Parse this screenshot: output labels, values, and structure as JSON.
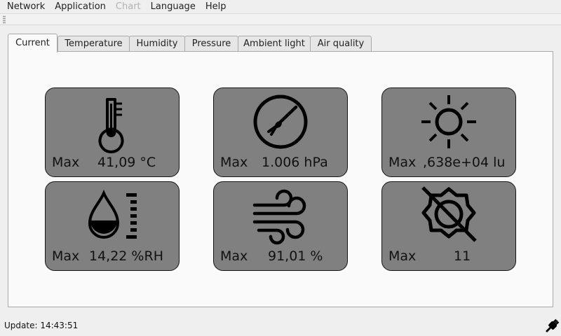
{
  "menu": {
    "network": "Network",
    "application": "Application",
    "chart": "Chart",
    "language": "Language",
    "help": "Help"
  },
  "tabs": {
    "current": "Current",
    "temperature": "Temperature",
    "humidity": "Humidity",
    "pressure": "Pressure",
    "ambient_light": "Ambient light",
    "air_quality": "Air quality"
  },
  "cards": {
    "temperature": {
      "icon": "thermometer-icon",
      "label": "Max",
      "value": "41,09 °C"
    },
    "pressure": {
      "icon": "gauge-icon",
      "label": "Max",
      "value": "1.006 hPa"
    },
    "ambient_light": {
      "icon": "sun-icon",
      "label": "Max",
      "value": ",638e+04 lu"
    },
    "humidity": {
      "icon": "water-drop-icon",
      "label": "Max",
      "value": "14,22 %RH"
    },
    "air_quality": {
      "icon": "wind-icon",
      "label": "Max",
      "value": "91,01 %"
    },
    "uv": {
      "icon": "uv-off-icon",
      "label": "Max",
      "value": "11"
    }
  },
  "status": {
    "update_text": "Update: 14:43:51",
    "connection_icon": "plug-icon"
  },
  "colors": {
    "card_background": "#808080",
    "panel_background": "#fafafa",
    "window_background": "#efefef",
    "disabled_text": "#b3b3b3"
  }
}
